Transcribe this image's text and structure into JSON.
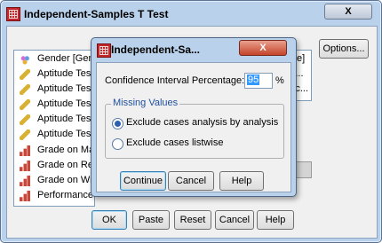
{
  "main_dialog": {
    "title": "Independent-Samples T Test",
    "close_glyph": "X",
    "options_button": "Options...",
    "variables": [
      {
        "label": "Gender [Gend",
        "type": "nominal-icon"
      },
      {
        "label": "Aptitude Test",
        "type": "scale-icon"
      },
      {
        "label": "Aptitude Test",
        "type": "scale-icon"
      },
      {
        "label": "Aptitude Test",
        "type": "scale-icon"
      },
      {
        "label": "Aptitude Test",
        "type": "scale-icon"
      },
      {
        "label": "Aptitude Test",
        "type": "scale-icon"
      },
      {
        "label": "Grade on Mat",
        "type": "ordinal-icon"
      },
      {
        "label": "Grade on Rea",
        "type": "ordinal-icon"
      },
      {
        "label": "Grade on Wri",
        "type": "ordinal-icon"
      },
      {
        "label": "Performance",
        "type": "ordinal-icon"
      }
    ],
    "right_fragments": [
      "e]",
      "S...",
      "Sc..."
    ],
    "buttons": {
      "ok": "OK",
      "paste": "Paste",
      "reset": "Reset",
      "cancel": "Cancel",
      "help": "Help"
    }
  },
  "options_dialog": {
    "title": "Independent-Sa...",
    "close_glyph": "X",
    "ci_label": "Confidence Interval Percentage:",
    "ci_value": "95",
    "ci_unit": "%",
    "missing_values_title": "Missing Values",
    "radio_analysis": "Exclude cases analysis by analysis",
    "radio_listwise": "Exclude cases listwise",
    "selected_option": "analysis",
    "buttons": {
      "continue": "Continue",
      "cancel": "Cancel",
      "help": "Help"
    }
  }
}
